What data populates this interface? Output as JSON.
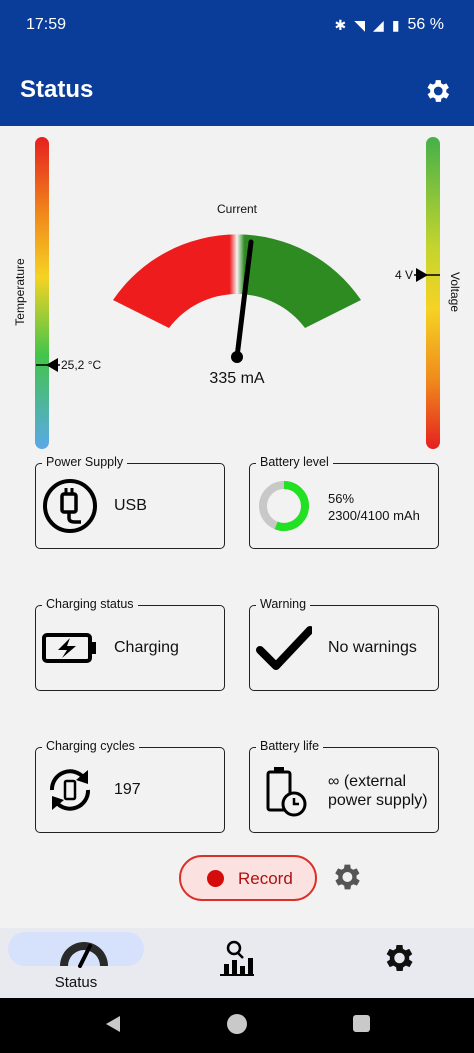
{
  "status_bar": {
    "time": "17:59",
    "battery_text": "56 %"
  },
  "app_bar": {
    "title": "Status"
  },
  "temperature": {
    "label": "Temperature",
    "value": "25,2 °C"
  },
  "voltage": {
    "label": "Voltage",
    "value": "4 V"
  },
  "gauge": {
    "title": "Current",
    "value": "335 mA"
  },
  "cards": {
    "power_supply": {
      "title": "Power Supply",
      "value": "USB"
    },
    "battery_level": {
      "title": "Battery level",
      "percent": "56%",
      "capacity": "2300/4100 mAh",
      "level_fraction": 0.56
    },
    "charging_status": {
      "title": "Charging status",
      "value": "Charging"
    },
    "warning": {
      "title": "Warning",
      "value": "No warnings"
    },
    "charging_cycles": {
      "title": "Charging cycles",
      "value": "197"
    },
    "battery_life": {
      "title": "Battery life",
      "line1": "∞ (external",
      "line2": "power supply)"
    }
  },
  "record": {
    "label": "Record"
  },
  "bottom_nav": {
    "status_label": "Status"
  },
  "colors": {
    "primary": "#0a3d99",
    "gauge_red": "#ee1c1c",
    "gauge_green": "#2e8b22",
    "ring_green": "#22e022",
    "record_red": "#d40c0c"
  }
}
